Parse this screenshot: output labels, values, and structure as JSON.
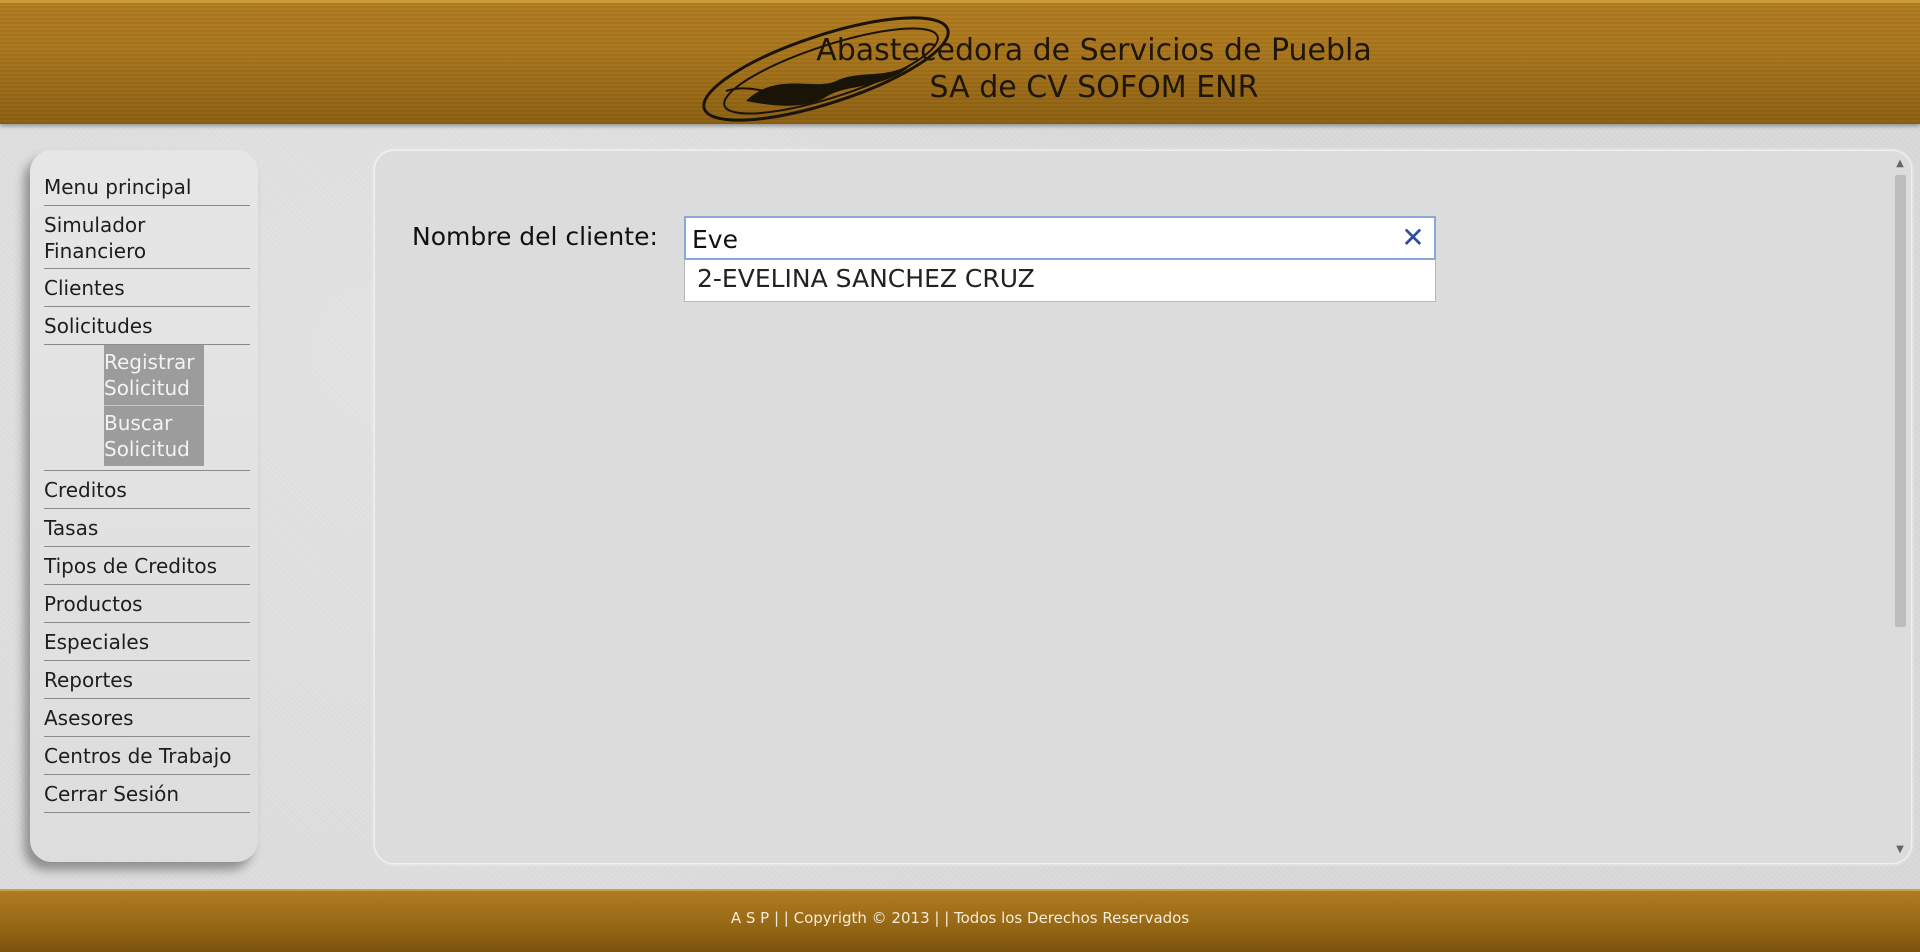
{
  "header": {
    "title_line1": "Abastecedora de Servicios de Puebla",
    "title_line2": "SA de CV SOFOM ENR",
    "colors": {
      "gold": "#a8751c",
      "dark_text": "#1e1608"
    }
  },
  "sidebar": {
    "items": [
      {
        "label": "Menu principal"
      },
      {
        "label": "Simulador Financiero"
      },
      {
        "label": "Clientes"
      },
      {
        "label": "Solicitudes"
      },
      {
        "label": "Creditos"
      },
      {
        "label": "Tasas"
      },
      {
        "label": "Tipos de Creditos"
      },
      {
        "label": "Productos"
      },
      {
        "label": "Especiales"
      },
      {
        "label": "Reportes"
      },
      {
        "label": "Asesores"
      },
      {
        "label": "Centros de Trabajo"
      },
      {
        "label": "Cerrar Sesión"
      }
    ],
    "subitems": [
      {
        "label": "Registrar Solicitud"
      },
      {
        "label": "Buscar Solicitud"
      }
    ]
  },
  "form": {
    "label": "Nombre del cliente:",
    "search_value": "Eve",
    "clear_icon": "close-icon",
    "suggestions": [
      {
        "label": "2-EVELINA SANCHEZ CRUZ"
      }
    ]
  },
  "footer": {
    "text": "A S P  | |  Copyrigth © 2013  | |  Todos los Derechos Reservados"
  }
}
